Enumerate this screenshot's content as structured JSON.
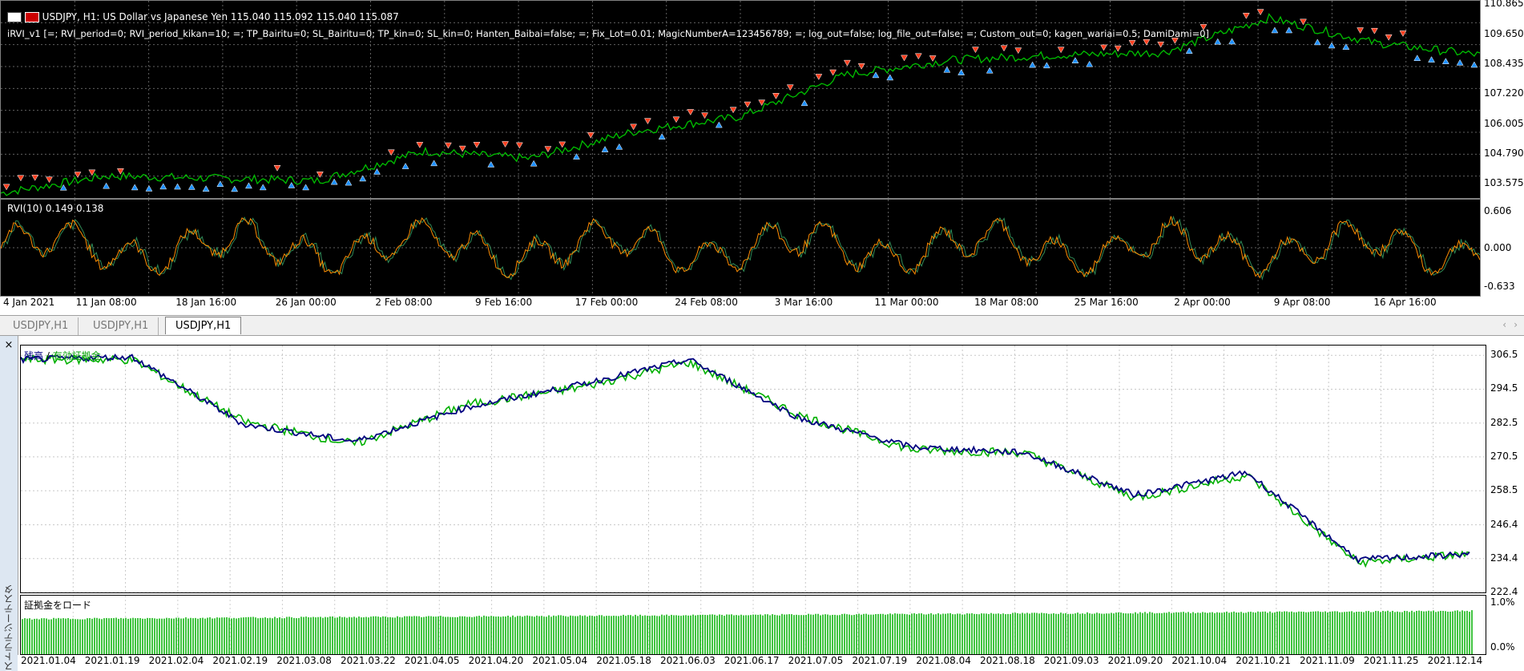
{
  "chart": {
    "symbol_line": "USDJPY, H1:  US Dollar vs Japanese Yen  115.040 115.092 115.040 115.087",
    "indicator_line": "iRVI_v1 [=; RVI_period=0; RVI_period_kikan=10; =; TP_Bairitu=0; SL_Bairitu=0; TP_kin=0; SL_kin=0; Hanten_Baibai=false; =; Fix_Lot=0.01; MagicNumberA=123456789; =; log_out=false; log_file_out=false; =; Custom_out=0; kagen_wariai=0.5;   DamiDami=0]",
    "rvi_label": "RVI(10) 0.149 0.138",
    "price_axis": [
      "110.865",
      "109.650",
      "108.435",
      "107.220",
      "106.005",
      "104.790",
      "103.575"
    ],
    "rvi_axis": [
      "0.606",
      "0.000",
      "-0.633"
    ],
    "time_axis": [
      "4 Jan 2021",
      "11 Jan 08:00",
      "18 Jan 16:00",
      "26 Jan 00:00",
      "2 Feb 08:00",
      "9 Feb 16:00",
      "17 Feb 00:00",
      "24 Feb 08:00",
      "3 Mar 16:00",
      "11 Mar 00:00",
      "18 Mar 08:00",
      "25 Mar 16:00",
      "2 Apr 00:00",
      "9 Apr 08:00",
      "16 Apr 16:00"
    ]
  },
  "tabs": [
    "USDJPY,H1",
    "USDJPY,H1",
    "USDJPY,H1"
  ],
  "tester": {
    "close_icon": "×",
    "vertical_label": "ストラテジーテスター",
    "legend_balance": "残高",
    "legend_sep": " / ",
    "legend_equity": "有効証拠金",
    "margin_label": "証拠金をロード",
    "balance_axis": [
      "306.5",
      "294.5",
      "282.5",
      "270.5",
      "258.5",
      "246.4",
      "234.4",
      "222.4"
    ],
    "margin_axis": [
      "1.0%",
      "0.0%"
    ],
    "date_axis": [
      "2021.01.04",
      "2021.01.19",
      "2021.02.04",
      "2021.02.19",
      "2021.03.08",
      "2021.03.22",
      "2021.04.05",
      "2021.04.20",
      "2021.05.04",
      "2021.05.18",
      "2021.06.03",
      "2021.06.17",
      "2021.07.05",
      "2021.07.19",
      "2021.08.04",
      "2021.08.18",
      "2021.09.03",
      "2021.09.20",
      "2021.10.04",
      "2021.10.21",
      "2021.11.09",
      "2021.11.25",
      "2021.12.14"
    ]
  },
  "colors": {
    "price_line": "#00c000",
    "sell_arrow": "#ff4020",
    "buy_arrow": "#1e90ff",
    "rvi_main": "#ff8c00",
    "rvi_signal": "#2e8b57",
    "balance": "#000080",
    "equity": "#00b000",
    "margin_bars": "#00b000"
  },
  "chart_data": [
    {
      "type": "line",
      "title": "USDJPY, H1",
      "x": [
        "4 Jan",
        "11 Jan",
        "18 Jan",
        "26 Jan",
        "2 Feb",
        "9 Feb",
        "17 Feb",
        "24 Feb",
        "3 Mar",
        "11 Mar",
        "18 Mar",
        "25 Mar",
        "2 Apr",
        "9 Apr",
        "16 Apr"
      ],
      "series": [
        {
          "name": "USDJPY",
          "values": [
            103.2,
            103.9,
            103.8,
            103.7,
            104.9,
            104.6,
            105.7,
            106.3,
            108.0,
            108.6,
            108.8,
            108.9,
            110.3,
            109.3,
            108.8
          ]
        }
      ],
      "ylim": [
        103.0,
        111.0
      ]
    },
    {
      "type": "line",
      "title": "",
      "x": [
        "2021.01.04",
        "2021.02.04",
        "2021.03.08",
        "2021.04.05",
        "2021.05.04",
        "2021.06.03",
        "2021.06.17",
        "2021.07.19",
        "2021.08.18",
        "2021.09.20",
        "2021.10.04",
        "2021.11.09",
        "2021.11.25",
        "2021.12.14"
      ],
      "series": [
        {
          "name": "残高",
          "values": [
            305,
            306,
            282,
            276,
            288,
            296,
            305,
            284,
            274,
            272,
            257,
            265,
            234,
            236
          ]
        },
        {
          "name": "有効証拠金",
          "values": [
            305,
            305,
            283,
            275,
            289,
            295,
            304,
            285,
            273,
            272,
            256,
            264,
            233,
            236
          ]
        }
      ],
      "ylim": [
        222.4,
        310.0
      ]
    }
  ]
}
